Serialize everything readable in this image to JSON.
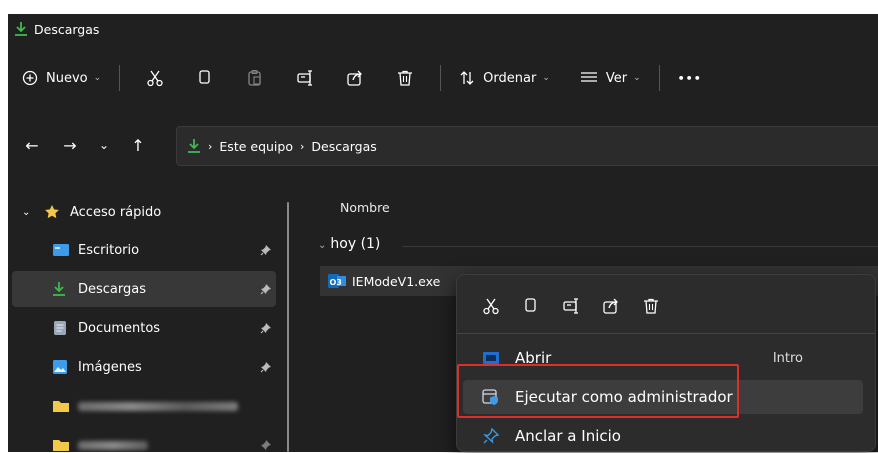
{
  "window": {
    "title": "Descargas"
  },
  "toolbar": {
    "new_label": "Nuevo",
    "sort_label": "Ordenar",
    "view_label": "Ver",
    "more_label": "•••"
  },
  "address": {
    "segments": [
      "Este equipo",
      "Descargas"
    ],
    "separator": "›"
  },
  "sidebar": {
    "quick_access": "Acceso rápido",
    "items": [
      {
        "label": "Escritorio",
        "icon": "desktop-folder-icon",
        "pinned": true
      },
      {
        "label": "Descargas",
        "icon": "download-icon",
        "pinned": true,
        "selected": true
      },
      {
        "label": "Documentos",
        "icon": "documents-folder-icon",
        "pinned": true
      },
      {
        "label": "Imágenes",
        "icon": "pictures-folder-icon",
        "pinned": true
      }
    ]
  },
  "content": {
    "column_name": "Nombre",
    "group_label": "hoy (1)",
    "file_name": "IEModeV1.exe",
    "file_badge": "O3"
  },
  "context_menu": {
    "items": [
      {
        "label": "Abrir",
        "shortcut": "Intro",
        "icon": "open-app-icon"
      },
      {
        "label": "Ejecutar como administrador",
        "shortcut": "",
        "icon": "run-as-admin-icon"
      },
      {
        "label": "Anclar a Inicio",
        "shortcut": "",
        "icon": "pin-icon"
      }
    ]
  },
  "colors": {
    "background": "#202020",
    "accent_green": "#3fb950",
    "highlight_red": "#d9302c",
    "folder_yellow": "#f2c84b",
    "folder_blue": "#3d9be9"
  }
}
